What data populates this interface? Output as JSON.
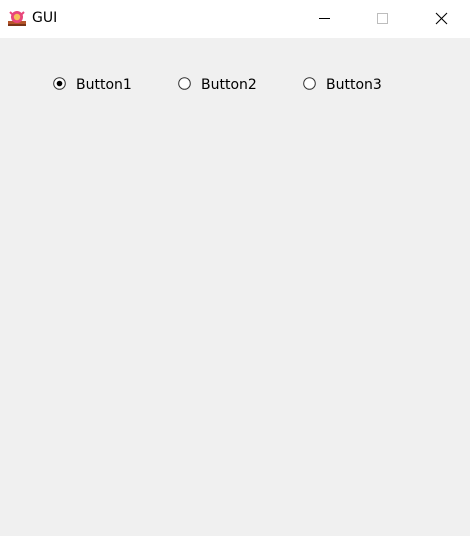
{
  "window": {
    "title": "GUI",
    "app_icon": "flame-emblem-icon",
    "controls": {
      "minimize_icon": "minimize-icon",
      "maximize_icon": "maximize-icon",
      "close_icon": "close-icon"
    }
  },
  "radio_group": {
    "selected": "Button1",
    "options": [
      {
        "label": "Button1",
        "checked": true
      },
      {
        "label": "Button2",
        "checked": false
      },
      {
        "label": "Button3",
        "checked": false
      }
    ]
  },
  "colors": {
    "titlebar_bg": "#ffffff",
    "client_bg": "#f0f0f0",
    "radio_border": "#333333",
    "radio_dot": "#000000"
  }
}
